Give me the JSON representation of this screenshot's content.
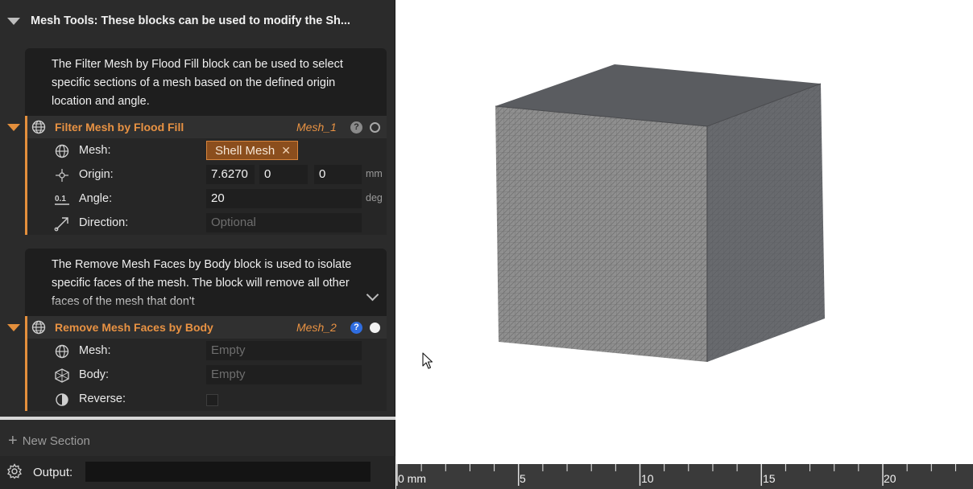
{
  "section": {
    "title": "Mesh Tools: These blocks can be used to modify the Sh..."
  },
  "notes": {
    "filter": "The Filter Mesh by Flood Fill block can be used to select specific sections of a mesh based on the defined origin location and angle.",
    "remove": "The Remove Mesh Faces by Body block is used to isolate specific faces of the mesh. The block will remove all other faces of the mesh that don't"
  },
  "blocks": [
    {
      "name": "Filter Mesh by Flood Fill",
      "variable": "Mesh_1",
      "help": "?",
      "icon": "globe-icon",
      "fields": {
        "mesh_label": "Mesh:",
        "mesh_chip": "Shell Mesh",
        "mesh_chip_remove": "✕",
        "origin_label": "Origin:",
        "origin_x": "7.6270",
        "origin_y": "0",
        "origin_z": "0",
        "origin_unit": "mm",
        "angle_label": "Angle:",
        "angle_value": "20",
        "angle_unit": "deg",
        "angle_icon_text": "0.1",
        "direction_label": "Direction:",
        "direction_placeholder": "Optional"
      }
    },
    {
      "name": "Remove Mesh Faces by Body",
      "variable": "Mesh_2",
      "help": "?",
      "icon": "globe-icon",
      "fields": {
        "mesh_label": "Mesh:",
        "mesh_placeholder": "Empty",
        "body_label": "Body:",
        "body_placeholder": "Empty",
        "reverse_label": "Reverse:",
        "reverse_checked": false
      }
    }
  ],
  "footer": {
    "new_section_icon": "+",
    "new_section": "New Section",
    "output_label": "Output:"
  },
  "ruler": {
    "labels": [
      "0 mm",
      "5",
      "10",
      "15",
      "20"
    ]
  },
  "colors": {
    "accent": "#e48f3c",
    "panel_bg": "#2b2b2b",
    "help_active": "#2f6de0",
    "cube_front": "#8d8d8d",
    "cube_side": "#66686c",
    "cube_top": "#585a5e"
  }
}
